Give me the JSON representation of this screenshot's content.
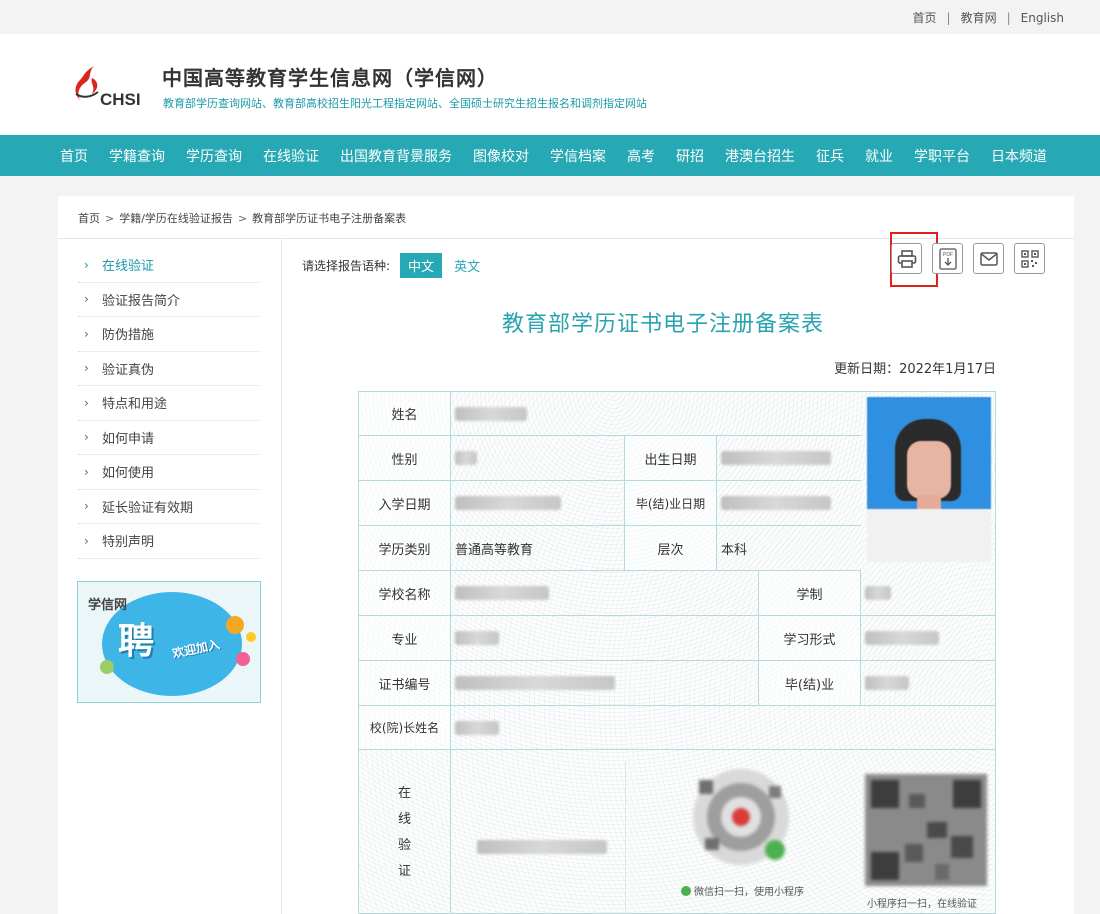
{
  "top_links": [
    "首页",
    "教育网",
    "English"
  ],
  "header": {
    "logo_text": "CHSI",
    "title": "中国高等教育学生信息网（学信网）",
    "subtitle": "教育部学历查询网站、教育部高校招生阳光工程指定网站、全国硕士研究生招生报名和调剂指定网站"
  },
  "nav": [
    "首页",
    "学籍查询",
    "学历查询",
    "在线验证",
    "出国教育背景服务",
    "图像校对",
    "学信档案",
    "高考",
    "研招",
    "港澳台招生",
    "征兵",
    "就业",
    "学职平台",
    "日本频道"
  ],
  "breadcrumb": [
    "首页",
    "学籍/学历在线验证报告",
    "教育部学历证书电子注册备案表"
  ],
  "sidebar": {
    "items": [
      "在线验证",
      "验证报告简介",
      "防伪措施",
      "验证真伪",
      "特点和用途",
      "如何申请",
      "如何使用",
      "延长验证有效期",
      "特别声明"
    ],
    "active_index": 0,
    "banner": {
      "logo": "学信网",
      "big": "聘",
      "text": "欢迎加入"
    }
  },
  "main": {
    "lang_label": "请选择报告语种:",
    "lang_options": [
      "中文",
      "英文"
    ],
    "lang_selected": "中文",
    "tools": [
      "print-icon",
      "pdf-download-icon",
      "mail-icon",
      "qrcode-icon"
    ],
    "doc_title": "教育部学历证书电子注册备案表",
    "update_date": "更新日期：2022年1月17日"
  },
  "cert": {
    "labels": {
      "name": "姓名",
      "gender": "性别",
      "birth": "出生日期",
      "enroll": "入学日期",
      "grad_date": "毕(结)业日期",
      "edu_type": "学历类别",
      "level": "层次",
      "school": "学校名称",
      "duration": "学制",
      "major": "专业",
      "study_form": "学习形式",
      "cert_no": "证书编号",
      "grad": "毕(结)业",
      "president": "校(院)长姓名",
      "online": [
        "在",
        "线",
        "验",
        "证"
      ]
    },
    "values": {
      "edu_type": "普通高等教育",
      "level": "本科"
    },
    "qr_captions": [
      "微信扫一扫，使用小程序",
      "小程序扫一扫，在线验证"
    ]
  },
  "colors": {
    "accent": "#26a9b4",
    "highlight": "#e2211c"
  }
}
